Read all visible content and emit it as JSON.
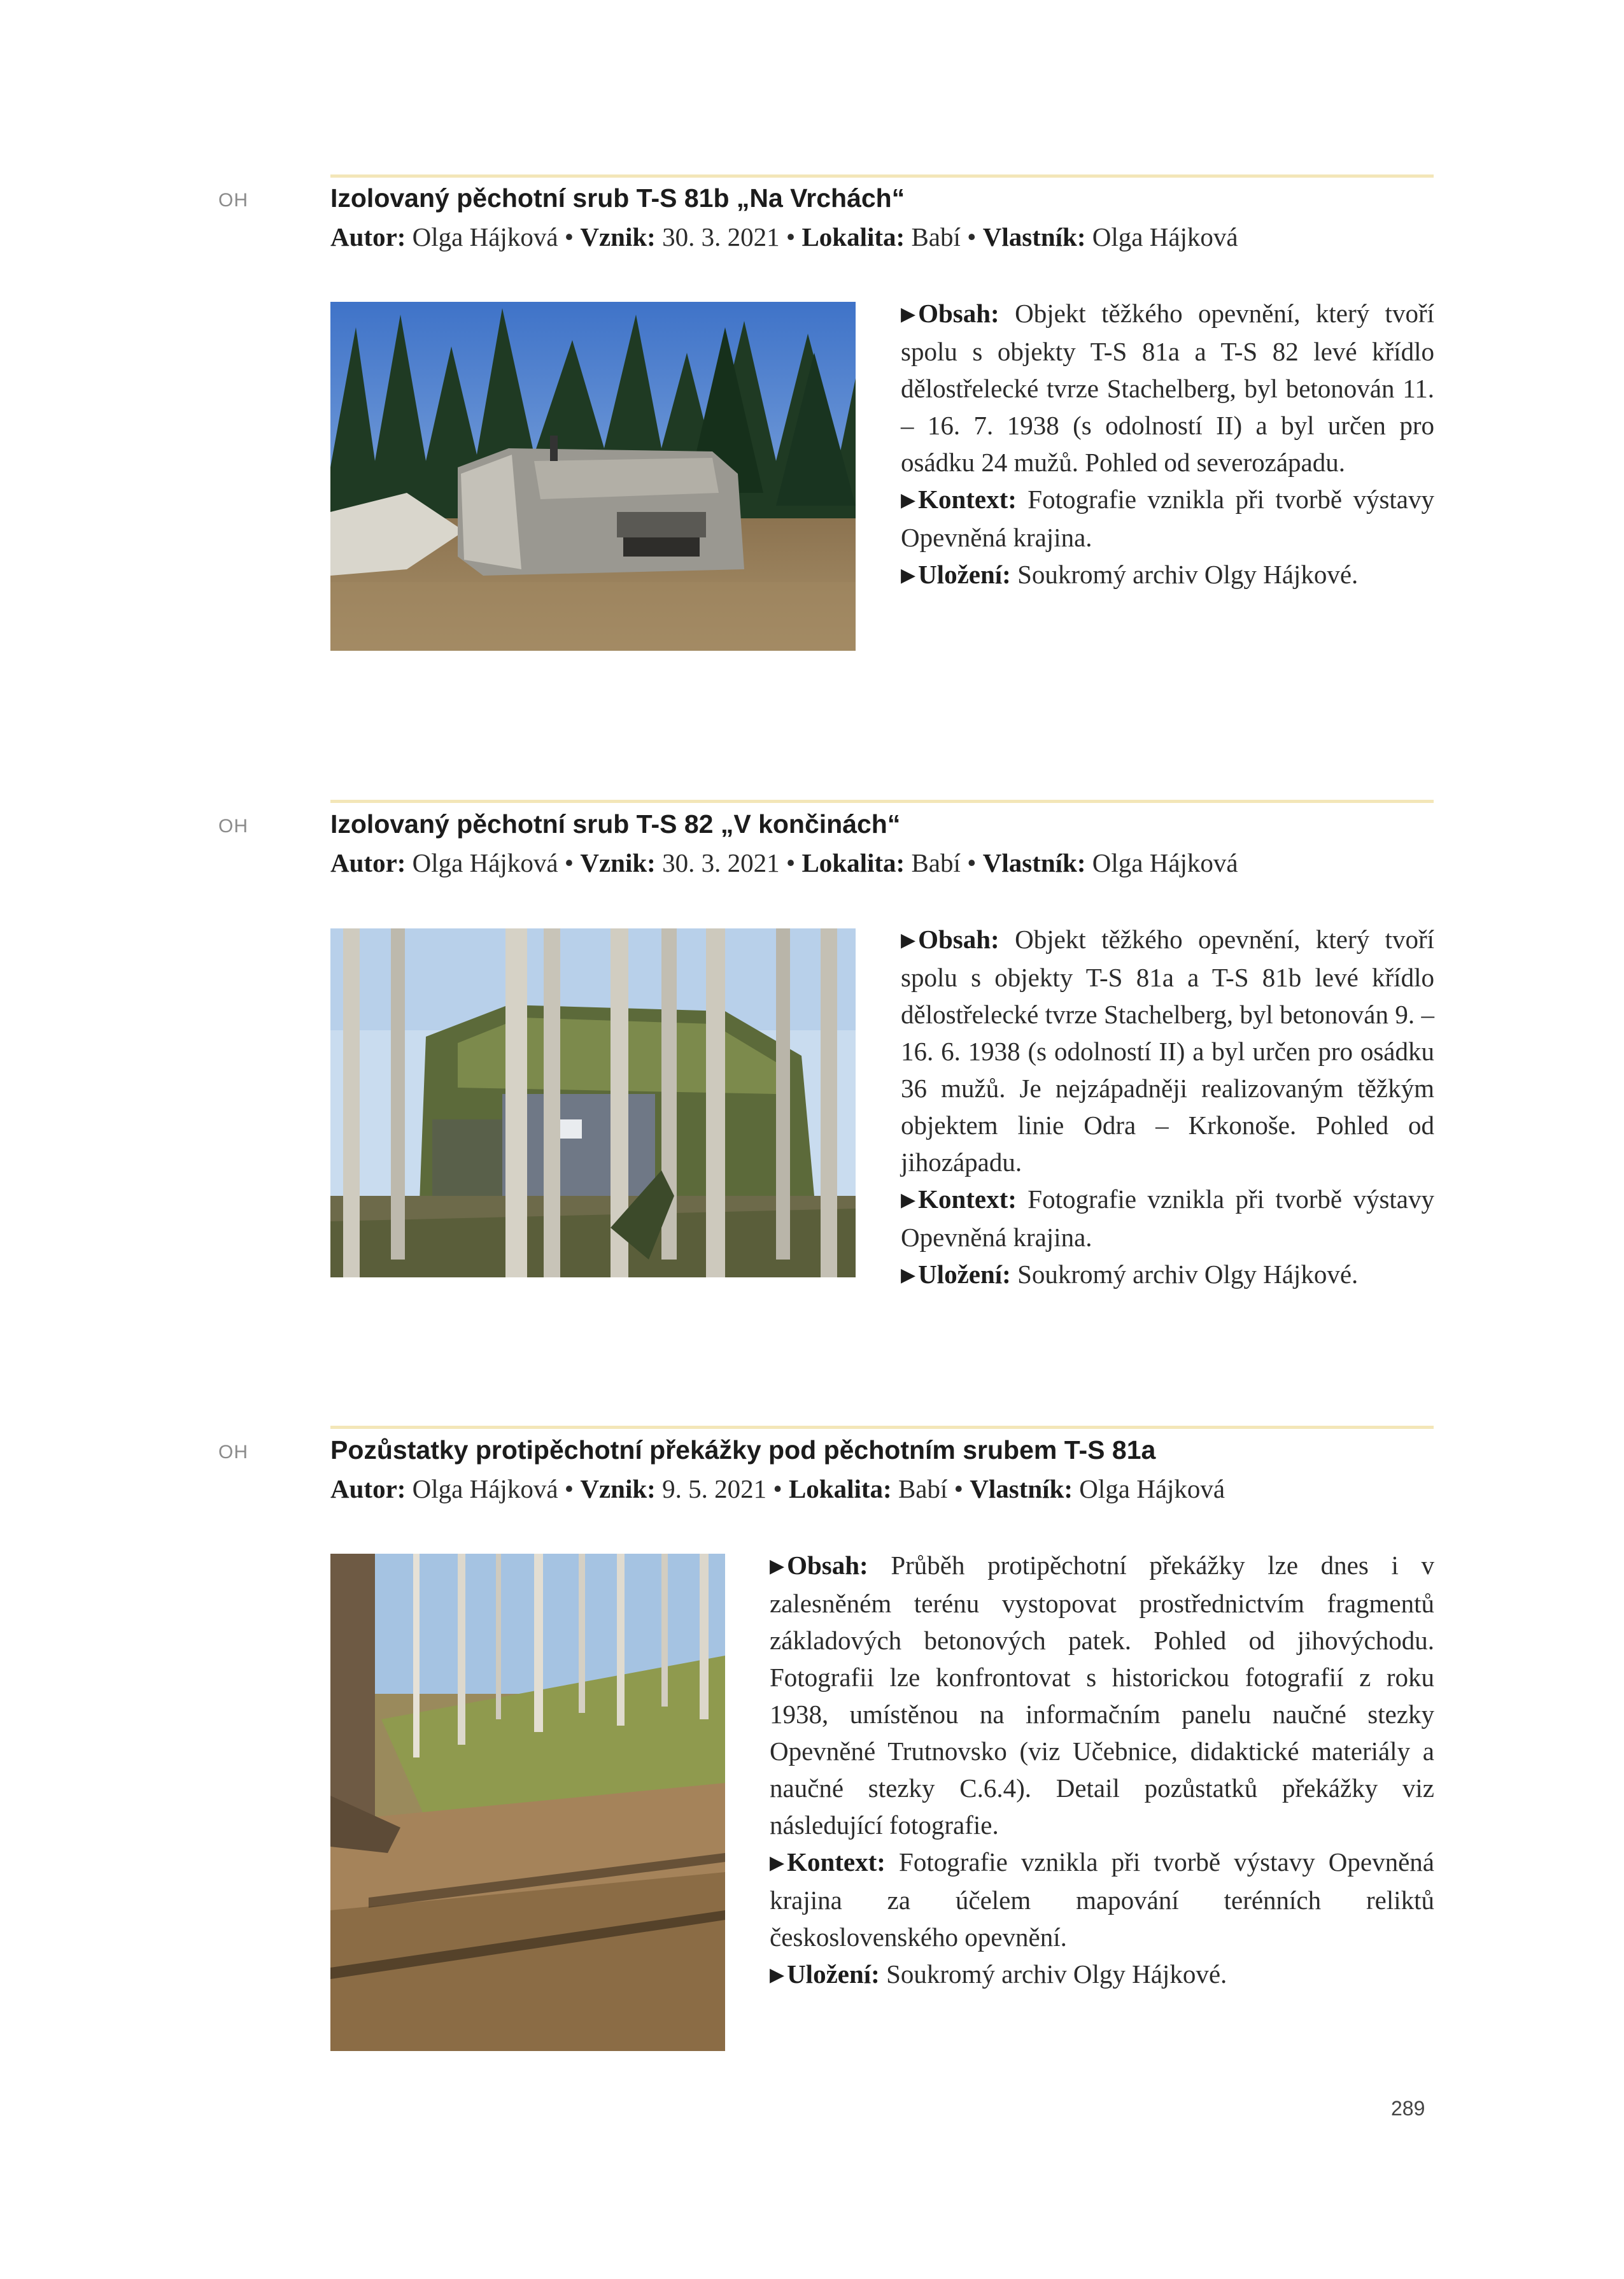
{
  "entries": [
    {
      "tag": "OH",
      "title": "Izolovaný pěchotní srub T-S 81b „Na Vrchách“",
      "meta": {
        "author_label": "Autor:",
        "author": "Olga Hájková",
        "created_label": "Vznik:",
        "created": "30. 3. 2021",
        "location_label": "Lokalita:",
        "location": "Babí",
        "owner_label": "Vlastník:",
        "owner": "Olga Hájková",
        "separator": "•"
      },
      "desc": {
        "content_label": "Obsah:",
        "content": "Objekt těžkého opevnění, který tvoří spolu s objekty T-S 81a a T-S 82 levé křídlo dělostřelecké tvrze Stachelberg, byl betonován 11. – 16. 7. 1938 (s odolností II) a byl určen pro osádku 24 mužů. Pohled od severozápadu.",
        "context_label": "Kontext:",
        "context": "Fotografie vznikla při tvorbě výstavy Opevněná krajina.",
        "storage_label": "Uložení:",
        "storage": "Soukromý archiv Olgy Hájkové."
      }
    },
    {
      "tag": "OH",
      "title": "Izolovaný pěchotní srub T-S 82 „V končinách“",
      "meta": {
        "author_label": "Autor:",
        "author": "Olga Hájková",
        "created_label": "Vznik:",
        "created": "30. 3. 2021",
        "location_label": "Lokalita:",
        "location": "Babí",
        "owner_label": "Vlastník:",
        "owner": "Olga Hájková",
        "separator": "•"
      },
      "desc": {
        "content_label": "Obsah:",
        "content": "Objekt těžkého opevnění, který tvoří spolu s objekty T-S 81a a T-S 81b levé křídlo dělostřelecké tvrze Stachelberg, byl betonován 9. – 16. 6. 1938 (s odolností II) a byl určen pro osádku 36 mužů. Je nejzápadněji realizovaným těžkým objektem linie Odra – Krkonoše. Pohled od jihozápadu.",
        "context_label": "Kontext:",
        "context": "Fotografie vznikla při tvorbě výstavy Opevněná krajina.",
        "storage_label": "Uložení:",
        "storage": "Soukromý archiv Olgy Hájkové."
      }
    },
    {
      "tag": "OH",
      "title": "Pozůstatky protipěchotní překážky pod pěchotním srubem T-S 81a",
      "meta": {
        "author_label": "Autor:",
        "author": "Olga Hájková",
        "created_label": "Vznik:",
        "created": "9. 5. 2021",
        "location_label": "Lokalita:",
        "location": "Babí",
        "owner_label": "Vlastník:",
        "owner": "Olga Hájková",
        "separator": "•"
      },
      "desc": {
        "content_label": "Obsah:",
        "content": "Průběh protipěchotní překážky lze dnes i v zalesněném terénu vystopovat prostřednictvím fragmentů základových betonových patek. Pohled od jihovýchodu. Fotografii lze konfrontovat s historickou fotografií z roku 1938, umístěnou na informačním panelu naučné stezky Opevněné Trutnovsko (viz Učebnice, didaktické materiály a naučné stezky C.6.4). Detail pozůstatků překážky viz následující fotografie.",
        "context_label": "Kontext:",
        "context": "Fotografie vznikla při tvorbě výstavy Opevněná krajina za účelem mapování terénních reliktů československého opevnění.",
        "storage_label": "Uložení:",
        "storage": "Soukromý archiv Olgy Hájkové."
      }
    }
  ],
  "page_number": "289",
  "icons": {
    "bullet": "triangle-right-icon"
  }
}
